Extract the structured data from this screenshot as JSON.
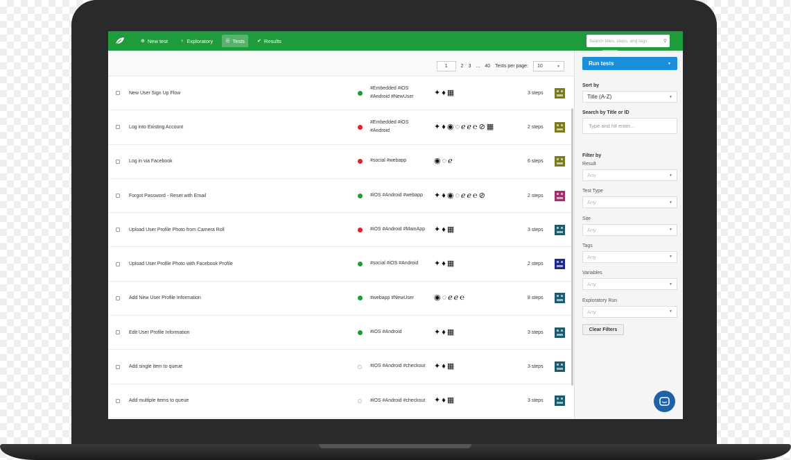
{
  "nav": {
    "items": [
      {
        "icon": "plus-circle-icon",
        "glyph": "⊕",
        "label": "New test",
        "active": false
      },
      {
        "icon": "bulb-icon",
        "glyph": "♀",
        "label": "Exploratory",
        "active": false
      },
      {
        "icon": "list-icon",
        "glyph": "☰",
        "label": "Tests",
        "active": true
      },
      {
        "icon": "check-circle-icon",
        "glyph": "✔",
        "label": "Results",
        "active": false
      }
    ],
    "search_placeholder": "Search titles, steps, and tags",
    "search_glyph": "⚲"
  },
  "pager": {
    "current_page": "1",
    "pages": [
      "2",
      "3",
      "...",
      "40"
    ],
    "per_page_label": "Tests per page:",
    "per_page_value": "10"
  },
  "tests": [
    {
      "title": "New User Sign Up Flow",
      "status": "pass",
      "tags": "#Embedded #iOS #Android #NewUser",
      "envs": [
        "android-icon",
        "apple-icon",
        "calendar-icon"
      ],
      "steps": "3 steps",
      "avatar_color": "#7a7a1e"
    },
    {
      "title": "Log into Existing Account",
      "status": "fail",
      "tags": "#Embedded #iOS #Android",
      "envs": [
        "android-icon",
        "apple-icon",
        "chrome-icon",
        "firefox-icon",
        "ie-icon",
        "ie-icon",
        "edge-icon",
        "safari-icon",
        "calendar-icon"
      ],
      "steps": "2 steps",
      "avatar_color": "#7a7a1e"
    },
    {
      "title": "Log in via Facebook",
      "status": "fail",
      "tags": "#social #webapp",
      "envs": [
        "chrome-icon",
        "firefox-icon",
        "ie-icon"
      ],
      "steps": "6 steps",
      "avatar_color": "#7a7a1e"
    },
    {
      "title": "Forgot Password - Reset with Email",
      "status": "pass",
      "tags": "#iOS #Android #webapp",
      "envs": [
        "android-icon",
        "apple-icon",
        "chrome-icon",
        "firefox-icon",
        "ie-icon",
        "ie-icon",
        "edge-icon",
        "safari-icon"
      ],
      "steps": "2 steps",
      "avatar_color": "#a0306a"
    },
    {
      "title": "Upload User Profile Photo from Camera Roll",
      "status": "fail",
      "tags": "#iOS #Android #MainApp",
      "envs": [
        "android-icon",
        "apple-icon",
        "calendar-icon"
      ],
      "steps": "3 steps",
      "avatar_color": "#1e5a6a"
    },
    {
      "title": "Upload User Profile Photo with Facebook Profile",
      "status": "pass",
      "tags": "#social #iOS #Android",
      "envs": [
        "android-icon",
        "apple-icon",
        "calendar-icon"
      ],
      "steps": "2 steps",
      "avatar_color": "#1e2a8a"
    },
    {
      "title": "Add New User Profile Information",
      "status": "pass",
      "tags": "#webapp #NewUser",
      "envs": [
        "chrome-icon",
        "firefox-icon",
        "ie-icon",
        "ie-icon",
        "edge-icon"
      ],
      "steps": "8 steps",
      "avatar_color": "#1e5a6a"
    },
    {
      "title": "Edit User Profile Information",
      "status": "pass",
      "tags": "#iOS #Android",
      "envs": [
        "android-icon",
        "apple-icon",
        "calendar-icon"
      ],
      "steps": "3 steps",
      "avatar_color": "#1e5a6a"
    },
    {
      "title": "Add single item to queue",
      "status": "none",
      "tags": "#iOS #Android #checkout",
      "envs": [
        "android-icon",
        "apple-icon",
        "calendar-icon"
      ],
      "steps": "3 steps",
      "avatar_color": "#1e5a6a"
    },
    {
      "title": "Add multiple items to queue",
      "status": "none",
      "tags": "#iOS #Android #checkout",
      "envs": [
        "android-icon",
        "apple-icon",
        "calendar-icon"
      ],
      "steps": "3 steps",
      "avatar_color": "#1e5a6a"
    }
  ],
  "env_glyphs": {
    "android-icon": "✦",
    "apple-icon": "♦",
    "calendar-icon": "▦",
    "chrome-icon": "◉",
    "firefox-icon": "◌",
    "ie-icon": "ℯ",
    "edge-icon": "℮",
    "safari-icon": "⊘"
  },
  "sidebar": {
    "run_label": "Run tests",
    "sort_label": "Sort by",
    "sort_value": "Title (A-Z)",
    "search_label": "Search by Title or ID",
    "search_placeholder": "Type and hit enter...",
    "filter_label": "Filter by",
    "filters": [
      {
        "label": "Result",
        "value": "Any"
      },
      {
        "label": "Test Type",
        "value": "Any"
      },
      {
        "label": "Site",
        "value": "Any"
      },
      {
        "label": "Tags",
        "value": "Any"
      },
      {
        "label": "Variables",
        "value": "Any"
      },
      {
        "label": "Exploratory Run",
        "value": "Any"
      }
    ],
    "clear_label": "Clear Filters"
  },
  "colors": {
    "brand_green": "#1e9b3a",
    "run_blue": "#1a8fdb",
    "pass": "#1e9b3a",
    "fail": "#e21f2b",
    "chat_blue": "#1c62a8"
  }
}
